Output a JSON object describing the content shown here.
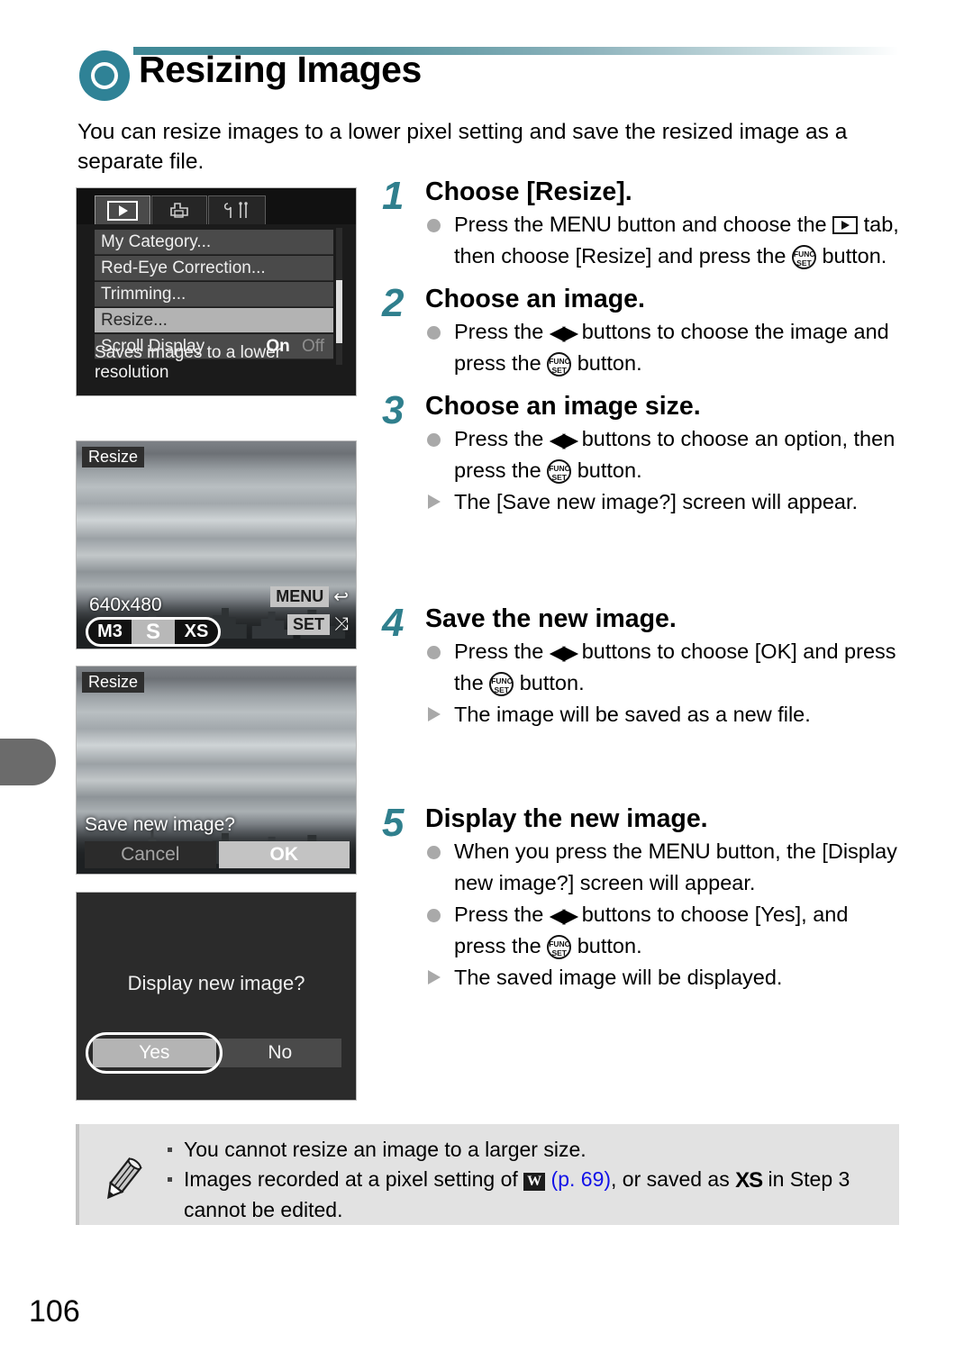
{
  "page": {
    "number": "106",
    "title": "Resizing Images",
    "intro": "You can resize images to a lower pixel setting and save the resized image as a separate file.",
    "accent_color": "#2f8296",
    "link_color": "#1212e8"
  },
  "menu_screen": {
    "tabs": [
      {
        "name": "playback-tab",
        "glyph": "play",
        "selected": true
      },
      {
        "name": "print-tab",
        "glyph": "⎙",
        "selected": false
      },
      {
        "name": "settings-tab",
        "glyph": "⑂⑂",
        "selected": false
      }
    ],
    "rows": [
      {
        "label": "My Category...",
        "value": "",
        "selected": false
      },
      {
        "label": "Red-Eye Correction...",
        "value": "",
        "selected": false
      },
      {
        "label": "Trimming...",
        "value": "",
        "selected": false
      },
      {
        "label": "Resize...",
        "value": "",
        "selected": true
      },
      {
        "label": "Scroll Display",
        "value_on": "On",
        "value_off": "Off",
        "selected": false
      }
    ],
    "hint": "Saves images to a lower resolution"
  },
  "size_screen": {
    "title": "Resize",
    "resolution": "640x480",
    "sizes": [
      {
        "label": "M3",
        "active": false
      },
      {
        "label": "S",
        "active": true
      },
      {
        "label": "XS",
        "active": false
      }
    ],
    "menu_badge": "MENU",
    "menu_icon": "↩",
    "set_badge": "SET",
    "set_icon": "⤨"
  },
  "save_screen": {
    "title": "Resize",
    "question": "Save new image?",
    "cancel_label": "Cancel",
    "ok_label": "OK"
  },
  "display_screen": {
    "question": "Display new image?",
    "yes_label": "Yes",
    "no_label": "No"
  },
  "steps": [
    {
      "num": "1",
      "title": "Choose [Resize].",
      "bullets": [
        {
          "type": "dot",
          "parts": [
            "Press the ",
            {
              "icon": "menu-text",
              "text": "MENU"
            },
            " button and choose the ",
            {
              "icon": "play-box"
            },
            " tab, then choose [Resize] and press the ",
            {
              "icon": "func-set"
            },
            " button."
          ]
        }
      ],
      "plain": [
        "Press the MENU button and choose the ▶ tab, then choose [Resize] and press the FUNC/SET button."
      ]
    },
    {
      "num": "2",
      "title": "Choose an image.",
      "plain": [
        "Press the ◀▶ buttons to choose the image and press the FUNC/SET button."
      ]
    },
    {
      "num": "3",
      "title": "Choose an image size.",
      "plain": [
        "Press the ◀▶ buttons to choose an option, then press the FUNC/SET button.",
        "The [Save new image?] screen will appear."
      ]
    },
    {
      "num": "4",
      "title": "Save the new image.",
      "plain": [
        "Press the ◀▶ buttons to choose [OK] and press the FUNC/SET button.",
        "The image will be saved as a new file."
      ]
    },
    {
      "num": "5",
      "title": "Display the new image.",
      "plain": [
        "When you press the MENU button, the [Display new image?] screen will appear.",
        "Press the ◀▶ buttons to choose [Yes], and press the FUNC/SET button.",
        "The saved image will be displayed."
      ]
    }
  ],
  "step_text": {
    "s1_a1": "Press the ",
    "s1_menu": "MENU",
    "s1_a2": " button and choose the ",
    "s1_a3": " tab, then choose [Resize] and press the ",
    "s1_a4": " button.",
    "s2_a1": "Press the ",
    "s2_a2": " buttons to choose the image and press the ",
    "s2_a3": " button.",
    "s3_a1": "Press the ",
    "s3_a2": " buttons to choose an option, then press the ",
    "s3_a3": " button.",
    "s3_b1": "The [Save new image?] screen will appear.",
    "s4_a1": "Press the ",
    "s4_a2": " buttons to choose [OK] and press the ",
    "s4_a3": " button.",
    "s4_b1": "The image will be saved as a new file.",
    "s5_a1": "When you press the ",
    "s5_menu": "MENU",
    "s5_a2": " button, the [Display new image?] screen will appear.",
    "s5_b1": "Press the ",
    "s5_b2": " buttons to choose [Yes], and press the ",
    "s5_b3": " button.",
    "s5_c1": "The saved image will be displayed."
  },
  "note": {
    "icon": "pencil-icon",
    "items": [
      {
        "text": "You cannot resize an image to a larger size."
      }
    ],
    "line1": "You cannot resize an image to a larger size.",
    "line2_a": "Images recorded at a pixel setting of ",
    "line2_w": "W",
    "line2_link": "(p. 69)",
    "line2_b": ", or saved as ",
    "line2_xs": "XS",
    "line2_c": " in Step 3 cannot be edited."
  }
}
